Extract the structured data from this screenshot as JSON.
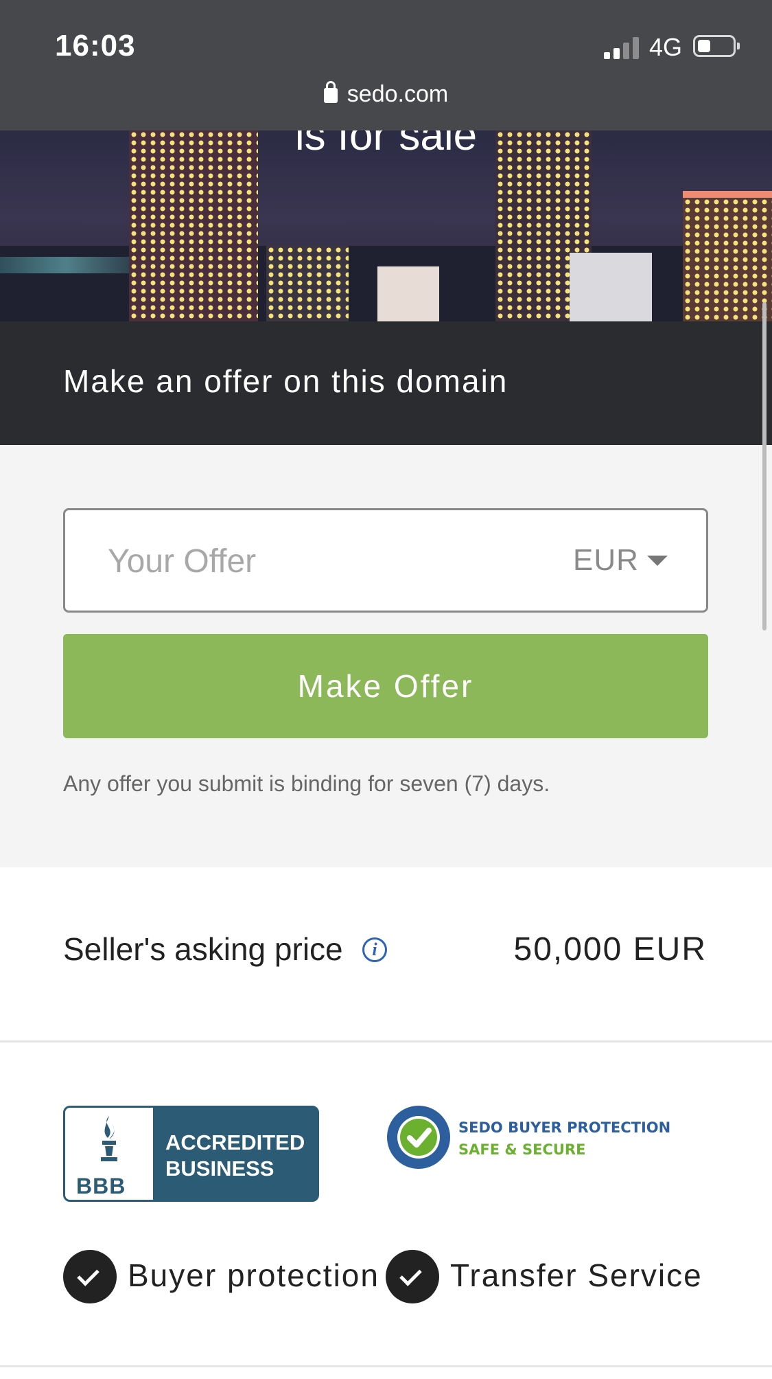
{
  "status_bar": {
    "time": "16:03",
    "network": "4G",
    "battery_level": 0.35,
    "signal_bars": 2
  },
  "browser": {
    "url": "sedo.com"
  },
  "hero": {
    "title": "is for sale"
  },
  "offer": {
    "heading": "Make an offer on this domain",
    "input_placeholder": "Your Offer",
    "input_value": "",
    "currency": "EUR",
    "button_label": "Make Offer",
    "note": "Any offer you submit is binding for seven (7) days."
  },
  "price": {
    "label": "Seller's asking price",
    "value": "50,000 EUR"
  },
  "trust": {
    "bbb_line1": "ACCREDITED",
    "bbb_line2": "BUSINESS",
    "bbb_brand": "BBB",
    "seal_line1": "SEDO BUYER PROTECTION",
    "seal_line2": "SAFE & SECURE",
    "features": [
      "Buyer protection",
      "Transfer Service"
    ]
  },
  "colors": {
    "accent_green": "#8cb85a",
    "dark_bar": "#2a2c30",
    "bbb_blue": "#2b5b75",
    "info_blue": "#2d63b8"
  }
}
